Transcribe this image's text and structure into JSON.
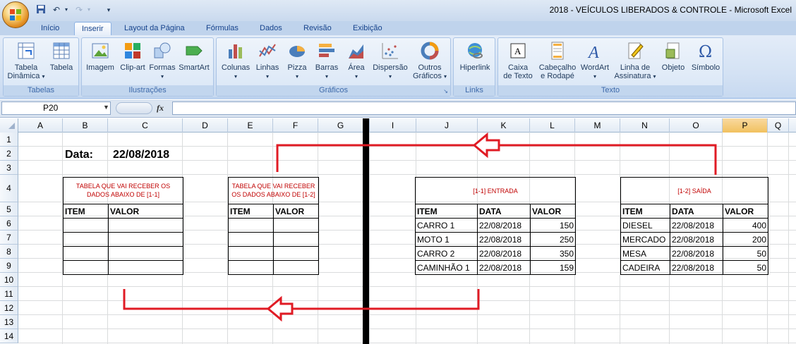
{
  "window": {
    "title": "2018 - VEÍCULOS LIBERADOS & CONTROLE - Microsoft Excel"
  },
  "tabs": [
    "Início",
    "Inserir",
    "Layout da Página",
    "Fórmulas",
    "Dados",
    "Revisão",
    "Exibição"
  ],
  "active_tab": "Inserir",
  "ribbon": {
    "tabelas": {
      "label": "Tabelas",
      "btn1a": "Tabela",
      "btn1b": "Dinâmica",
      "btn2": "Tabela"
    },
    "ilustracoes": {
      "label": "Ilustrações",
      "imagem": "Imagem",
      "clipart": "Clip-art",
      "formas": "Formas",
      "smartart": "SmartArt"
    },
    "graficos": {
      "label": "Gráficos",
      "colunas": "Colunas",
      "linhas": "Linhas",
      "pizza": "Pizza",
      "barras": "Barras",
      "area": "Área",
      "dispersao": "Dispersão",
      "outros_a": "Outros",
      "outros_b": "Gráficos"
    },
    "links": {
      "label": "Links",
      "hiperlink": "Hiperlink"
    },
    "texto": {
      "label": "Texto",
      "caixa_a": "Caixa",
      "caixa_b": "de Texto",
      "cab_a": "Cabeçalho",
      "cab_b": "e Rodapé",
      "wordart": "WordArt",
      "linha_a": "Linha de",
      "linha_b": "Assinatura",
      "objeto": "Objeto",
      "simbolo": "Símbolo"
    }
  },
  "formula_bar": {
    "name_box": "P20",
    "fx": "fx",
    "value": ""
  },
  "columns": [
    "A",
    "B",
    "C",
    "D",
    "E",
    "F",
    "G",
    "H",
    "I",
    "J",
    "K",
    "L",
    "M",
    "N",
    "O",
    "P",
    "Q"
  ],
  "rows": [
    "1",
    "2",
    "3",
    "4",
    "5",
    "6",
    "7",
    "8",
    "9",
    "10",
    "11",
    "12",
    "13",
    "14"
  ],
  "sheet": {
    "data_label": "Data:",
    "data_value": "22/08/2018",
    "table_a_note": "TABELA QUE VAI RECEBER OS DADOS ABAIXO DE [1-1]",
    "table_b_note": "TABELA QUE VAI RECEBER OS DADOS ABAIXO DE [1-2]",
    "item": "ITEM",
    "valor": "VALOR",
    "data": "DATA",
    "entrada_title": "[1-1] ENTRADA",
    "saida_title": "[1-2] SAÍDA",
    "entrada": [
      {
        "item": "CARRO 1",
        "data": "22/08/2018",
        "valor": "150"
      },
      {
        "item": "MOTO 1",
        "data": "22/08/2018",
        "valor": "250"
      },
      {
        "item": "CARRO 2",
        "data": "22/08/2018",
        "valor": "350"
      },
      {
        "item": "CAMINHÃO 1",
        "data": "22/08/2018",
        "valor": "159"
      }
    ],
    "saida": [
      {
        "item": "DIESEL",
        "data": "22/08/2018",
        "valor": "400"
      },
      {
        "item": "MERCADO",
        "data": "22/08/2018",
        "valor": "200"
      },
      {
        "item": "MESA",
        "data": "22/08/2018",
        "valor": "50"
      },
      {
        "item": "CADEIRA",
        "data": "22/08/2018",
        "valor": "50"
      }
    ]
  },
  "colors": {
    "accent_red": "#e01b24",
    "divider": "#000000"
  }
}
